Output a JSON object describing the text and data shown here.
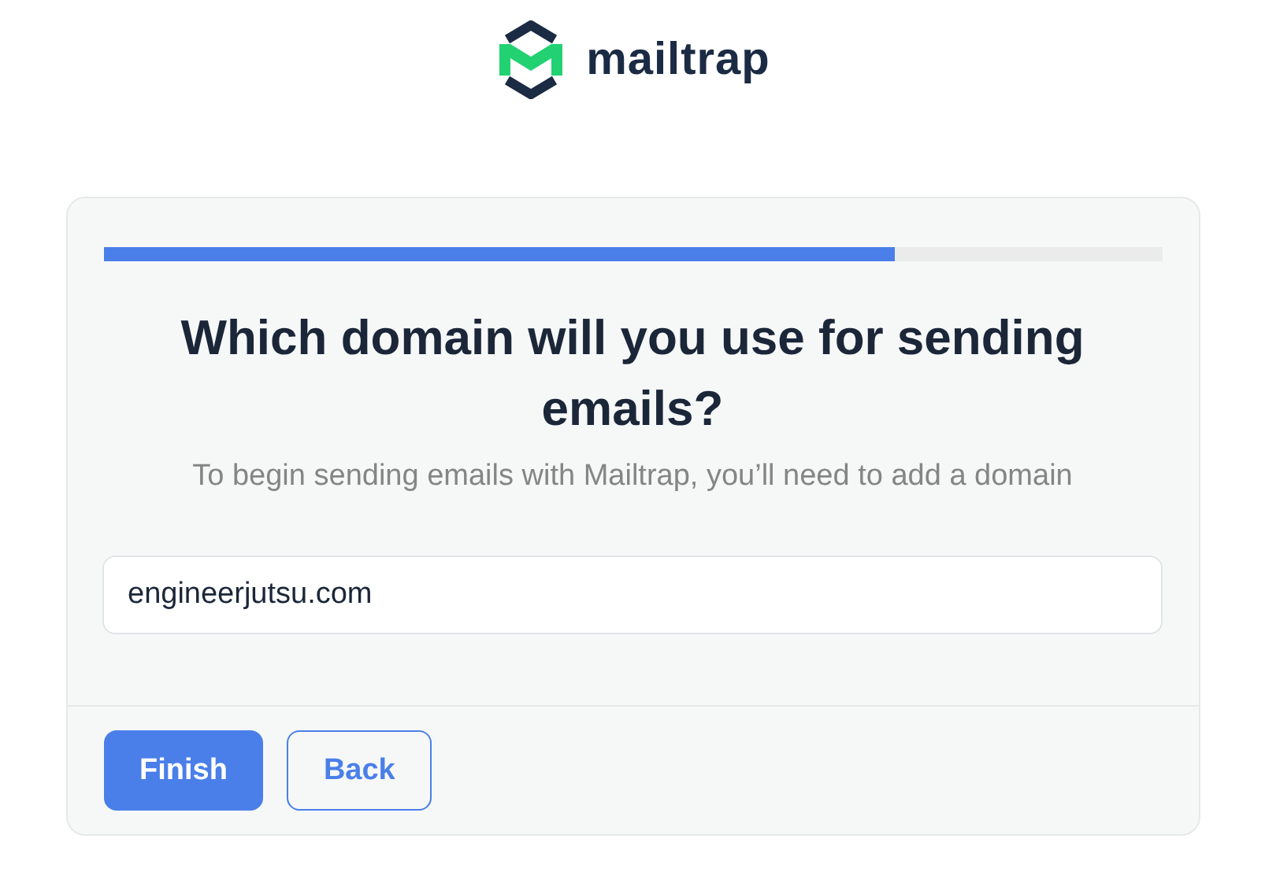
{
  "logo": {
    "text": "mailtrap"
  },
  "progress": {
    "level": 0.75
  },
  "heading": "Which domain will you use for sending emails?",
  "subtitle": "To begin sending emails with Mailtrap, you’ll need to add a domain",
  "domain_field": {
    "value": "engineerjutsu.com"
  },
  "buttons": [
    {
      "kind": "primary",
      "label": "Finish"
    },
    {
      "kind": "secondary",
      "label": "Back"
    }
  ]
}
